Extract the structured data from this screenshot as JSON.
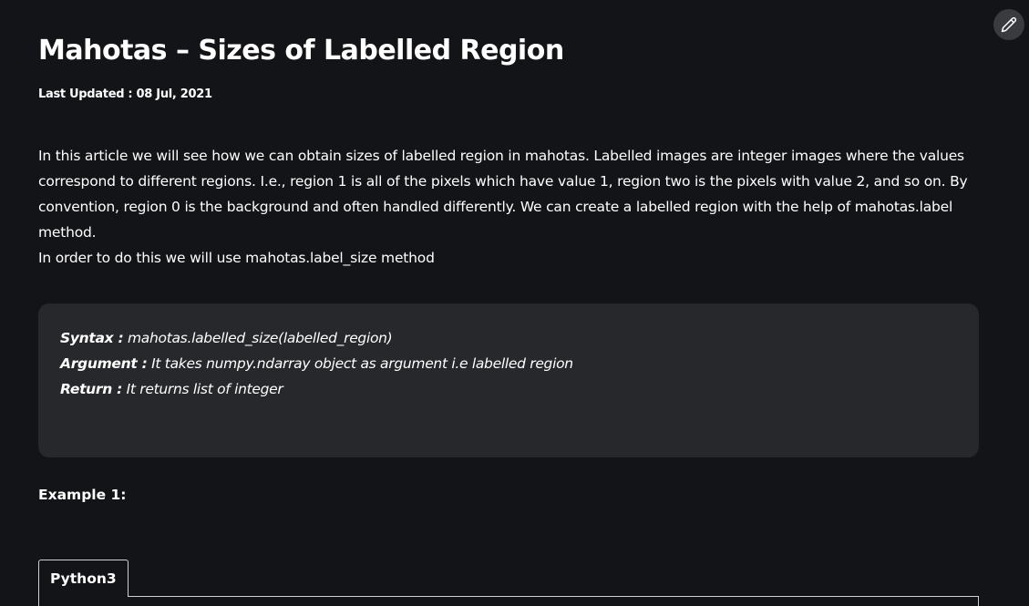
{
  "article": {
    "title": "Mahotas – Sizes of Labelled Region",
    "last_updated": "Last Updated : 08 Jul, 2021",
    "paragraphs": [
      "In this article we will see how we can obtain sizes of labelled region in mahotas. Labelled images are integer images where the values correspond to different regions. I.e., region 1 is all of the pixels which have value 1, region two is the pixels with value 2, and so on. By convention, region 0 is the background and often handled differently. We can create a labelled region with the help of mahotas.label method.",
      "In order to do this we will use mahotas.label_size method"
    ],
    "syntax_box": {
      "syntax_label": "Syntax :",
      "syntax_value": " mahotas.labelled_size(labelled_region)",
      "argument_label": "Argument :",
      "argument_value": " It takes numpy.ndarray object as argument i.e labelled region",
      "return_label": "Return :",
      "return_value": " It returns list of integer"
    },
    "example_heading": "Example 1:",
    "code_tab_label": "Python3"
  },
  "icons": {
    "edit": "pencil-icon"
  },
  "colors": {
    "background": "#131417",
    "syntax_box_bg": "#27282b",
    "edit_button_bg": "#3a3b3e",
    "text": "#ffffff"
  }
}
